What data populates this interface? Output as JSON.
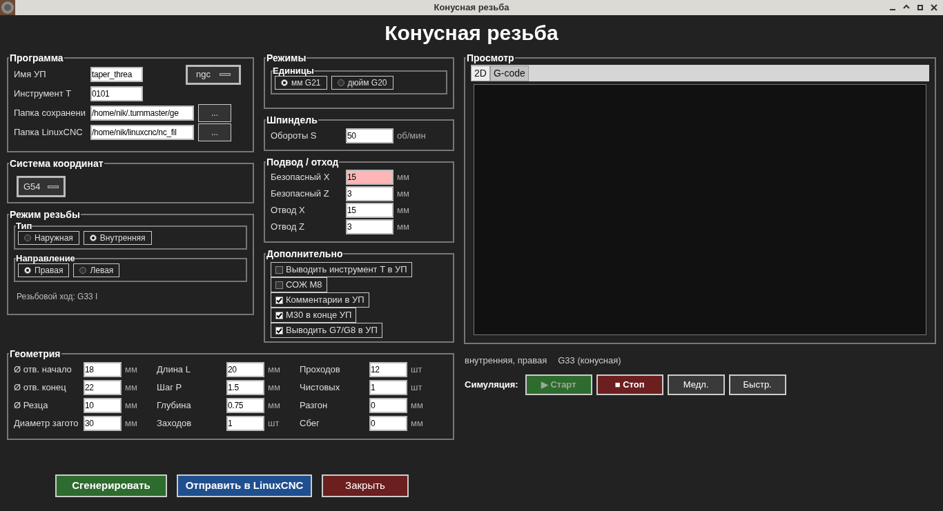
{
  "window": {
    "title": "Конусная резьба"
  },
  "heading": "Конусная резьба",
  "program": {
    "title": "Программа",
    "fields": [
      {
        "label": "Имя УП",
        "value": "taper_threa",
        "menu": "ngc"
      },
      {
        "label": "Инструмент T",
        "value": "0101"
      },
      {
        "label": "Папка сохранени",
        "value": "/home/nik/.turnmaster/ge",
        "button": "..."
      },
      {
        "label": "Папка LinuxCNC",
        "value": "/home/nik/linuxcnc/nc_fil",
        "button": "..."
      }
    ]
  },
  "coordinates": {
    "title": "Система координат",
    "menu": "G54"
  },
  "thread_mode": {
    "title": "Режим резьбы",
    "groups": [
      {
        "title": "Тип",
        "options": [
          {
            "label": "Наружная",
            "selected": false
          },
          {
            "label": "Внутренняя",
            "selected": true
          }
        ]
      },
      {
        "title": "Направление",
        "options": [
          {
            "label": "Правая",
            "selected": true
          },
          {
            "label": "Левая",
            "selected": false
          }
        ]
      }
    ],
    "note": "Резьбовой ход: G33 I"
  },
  "modes": {
    "title": "Режимы",
    "groups": [
      {
        "title": "Единицы",
        "options": [
          {
            "label": "мм G21",
            "selected": true
          },
          {
            "label": "дюйм G20",
            "selected": false
          }
        ]
      }
    ]
  },
  "spindle": {
    "title": "Шпиндель",
    "rows": [
      {
        "label": "Обороты S",
        "value": "50",
        "unit": "об/мин",
        "highlighted": false
      }
    ]
  },
  "approach": {
    "title": "Подвод / отход",
    "rows": [
      {
        "label": "Безопасный X",
        "value": "15",
        "unit": "мм",
        "highlighted": true
      },
      {
        "label": "Безопасный Z",
        "value": "3",
        "unit": "мм",
        "highlighted": false
      },
      {
        "label": "Отвод X",
        "value": "15",
        "unit": "мм",
        "highlighted": false
      },
      {
        "label": "Отвод Z",
        "value": "3",
        "unit": "мм",
        "highlighted": false
      }
    ]
  },
  "extra": {
    "title": "Дополнительно",
    "checkboxes": [
      {
        "label": "Выводить инструмент T в УП",
        "checked": false
      },
      {
        "label": "СОЖ M8",
        "checked": false
      },
      {
        "label": "Комментарии в УП",
        "checked": true
      },
      {
        "label": "M30 в конце УП",
        "checked": true
      },
      {
        "label": "Выводить G7/G8 в УП",
        "checked": true
      }
    ]
  },
  "geometry": {
    "title": "Геометрия",
    "columns": [
      [
        {
          "label": "Ø отв. начало",
          "value": "18",
          "unit": "мм"
        },
        {
          "label": "Ø отв. конец",
          "value": "22",
          "unit": "мм"
        },
        {
          "label": "Ø Резца",
          "value": "10",
          "unit": "мм"
        },
        {
          "label": "Диаметр загото",
          "value": "30",
          "unit": "мм"
        }
      ],
      [
        {
          "label": "Длина L",
          "value": "20",
          "unit": "мм"
        },
        {
          "label": "Шаг P",
          "value": "1.5",
          "unit": "мм"
        },
        {
          "label": "Глубина",
          "value": "0.75",
          "unit": "мм"
        },
        {
          "label": "Заходов",
          "value": "1",
          "unit": "шт"
        }
      ],
      [
        {
          "label": "Проходов",
          "value": "12",
          "unit": "шт"
        },
        {
          "label": "Чистовых",
          "value": "1",
          "unit": "шт"
        },
        {
          "label": "Разгон",
          "value": "0",
          "unit": "мм"
        },
        {
          "label": "Сбег",
          "value": "0",
          "unit": "мм"
        }
      ]
    ]
  },
  "actions": [
    {
      "label": "Сгенерировать",
      "kind": "generate"
    },
    {
      "label": "Отправить в LinuxCNC",
      "kind": "send"
    },
    {
      "label": "Закрыть",
      "kind": "close"
    }
  ],
  "preview": {
    "title": "Просмотр",
    "tabs": [
      {
        "label": "2D",
        "selected": true
      },
      {
        "label": "G-code",
        "selected": false
      }
    ]
  },
  "status": [
    "внутренняя, правая",
    "G33 (конусная)"
  ],
  "simulation": {
    "label": "Симуляция:",
    "buttons": [
      {
        "label": "▶ Старт",
        "kind": "start",
        "disabled": true
      },
      {
        "label": "■ Стоп",
        "kind": "stop",
        "disabled": false
      },
      {
        "label": "Медл.",
        "kind": "plain",
        "disabled": false
      },
      {
        "label": "Быстр.",
        "kind": "plain",
        "disabled": false
      }
    ]
  }
}
